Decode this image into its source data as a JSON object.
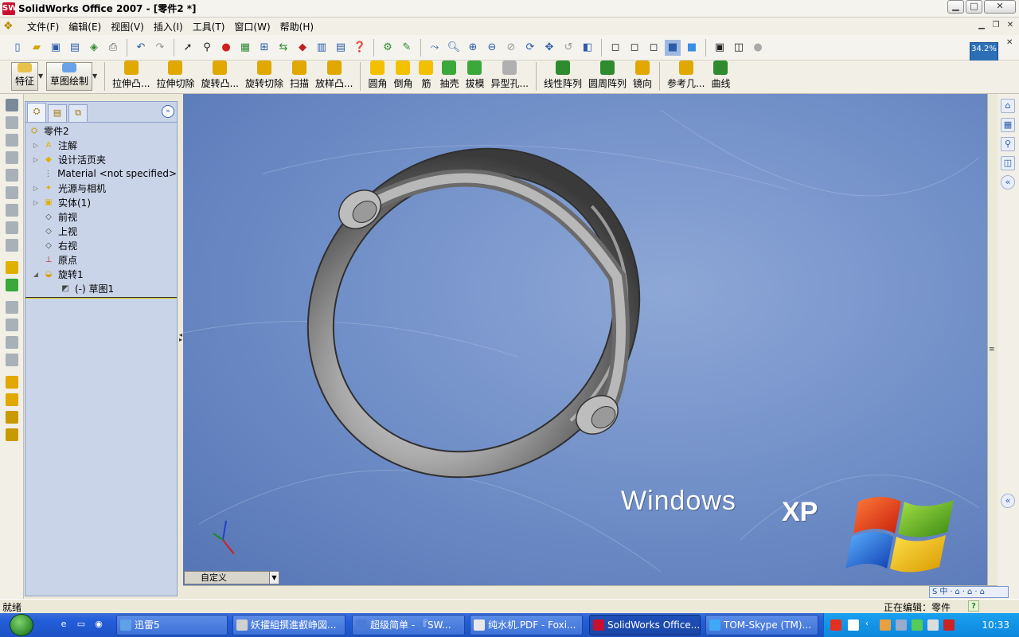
{
  "window": {
    "title": "SolidWorks Office 2007 - [零件2 *]",
    "min_label": "▁",
    "max_label": "□",
    "close_label": "✕"
  },
  "menu": {
    "items": [
      "文件(F)",
      "编辑(E)",
      "视图(V)",
      "插入(I)",
      "工具(T)",
      "窗口(W)",
      "帮助(H)"
    ]
  },
  "toolbar": {
    "zoom_level": "34.2%"
  },
  "command_manager": {
    "tabs": [
      {
        "label": "特征",
        "icon": "features-icon"
      },
      {
        "label": "草图绘制",
        "icon": "sketch-icon"
      }
    ],
    "commands": [
      {
        "label": "拉伸凸...",
        "icon": "extruded-boss-icon",
        "color": "#e0a800"
      },
      {
        "label": "拉伸切除",
        "icon": "extruded-cut-icon",
        "color": "#e0a800"
      },
      {
        "label": "旋转凸...",
        "icon": "revolved-boss-icon",
        "color": "#e0a800"
      },
      {
        "label": "旋转切除",
        "icon": "revolved-cut-icon",
        "color": "#e0a800"
      },
      {
        "label": "扫描",
        "icon": "sweep-icon",
        "color": "#e0a800"
      },
      {
        "label": "放样凸...",
        "icon": "loft-icon",
        "color": "#e0a800"
      },
      {
        "label": "圆角",
        "icon": "fillet-icon",
        "color": "#f3c000"
      },
      {
        "label": "倒角",
        "icon": "chamfer-icon",
        "color": "#f3c000"
      },
      {
        "label": "筋",
        "icon": "rib-icon",
        "color": "#f3c000"
      },
      {
        "label": "抽壳",
        "icon": "shell-icon",
        "color": "#3aa83a"
      },
      {
        "label": "拔模",
        "icon": "draft-icon",
        "color": "#3aa83a"
      },
      {
        "label": "异型孔...",
        "icon": "hole-wizard-icon",
        "color": "#b0b0b0"
      },
      {
        "label": "线性阵列",
        "icon": "linear-pattern-icon",
        "color": "#2e8b2e"
      },
      {
        "label": "圆周阵列",
        "icon": "circular-pattern-icon",
        "color": "#2e8b2e"
      },
      {
        "label": "镜向",
        "icon": "mirror-icon",
        "color": "#e0a800"
      },
      {
        "label": "参考几...",
        "icon": "reference-geometry-icon",
        "color": "#e0a800"
      },
      {
        "label": "曲线",
        "icon": "curves-icon",
        "color": "#2e8b2e"
      }
    ]
  },
  "feature_tree": {
    "root": "零件2",
    "items": [
      {
        "label": "注解",
        "icon": "annotations-icon",
        "expander": "▷"
      },
      {
        "label": "设计活页夹",
        "icon": "design-binder-icon",
        "expander": "▷"
      },
      {
        "label": "Material <not specified>",
        "icon": "material-icon",
        "expander": ""
      },
      {
        "label": "光源与相机",
        "icon": "lights-cameras-icon",
        "expander": "▷"
      },
      {
        "label": "实体(1)",
        "icon": "solid-bodies-icon",
        "expander": "▷"
      },
      {
        "label": "前视",
        "icon": "plane-icon",
        "expander": ""
      },
      {
        "label": "上视",
        "icon": "plane-icon",
        "expander": ""
      },
      {
        "label": "右视",
        "icon": "plane-icon",
        "expander": ""
      },
      {
        "label": "原点",
        "icon": "origin-icon",
        "expander": ""
      },
      {
        "label": "旋转1",
        "icon": "revolve-feature-icon",
        "expander": "◢"
      },
      {
        "label": "(-) 草图1",
        "icon": "sketch-icon",
        "expander": "",
        "indent": true
      }
    ]
  },
  "viewport": {
    "config_label": "自定义",
    "watermark": "Windows",
    "watermark_xp": "XP"
  },
  "ime_bar": {
    "text": "S中·⌂·⌂·⌂"
  },
  "status": {
    "left": "就绪",
    "right": "正在编辑：零件",
    "help": "?"
  },
  "taskbar": {
    "tasks": [
      {
        "label": "迅雷5",
        "icon_color": "#5fa0e8"
      },
      {
        "label": "妖攉組撰進叡峥図...",
        "icon_color": "#d0d0d0"
      },
      {
        "label": "超级简单 - 『SW...",
        "icon_color": "#4a7bd8"
      },
      {
        "label": "纯水机.PDF - Foxi...",
        "icon_color": "#e8e8e8"
      },
      {
        "label": "SolidWorks Office...",
        "icon_color": "#c8102e",
        "active": true
      },
      {
        "label": "TOM-Skype (TM)...",
        "icon_color": "#3fa9f5"
      }
    ],
    "clock": "10:33"
  }
}
